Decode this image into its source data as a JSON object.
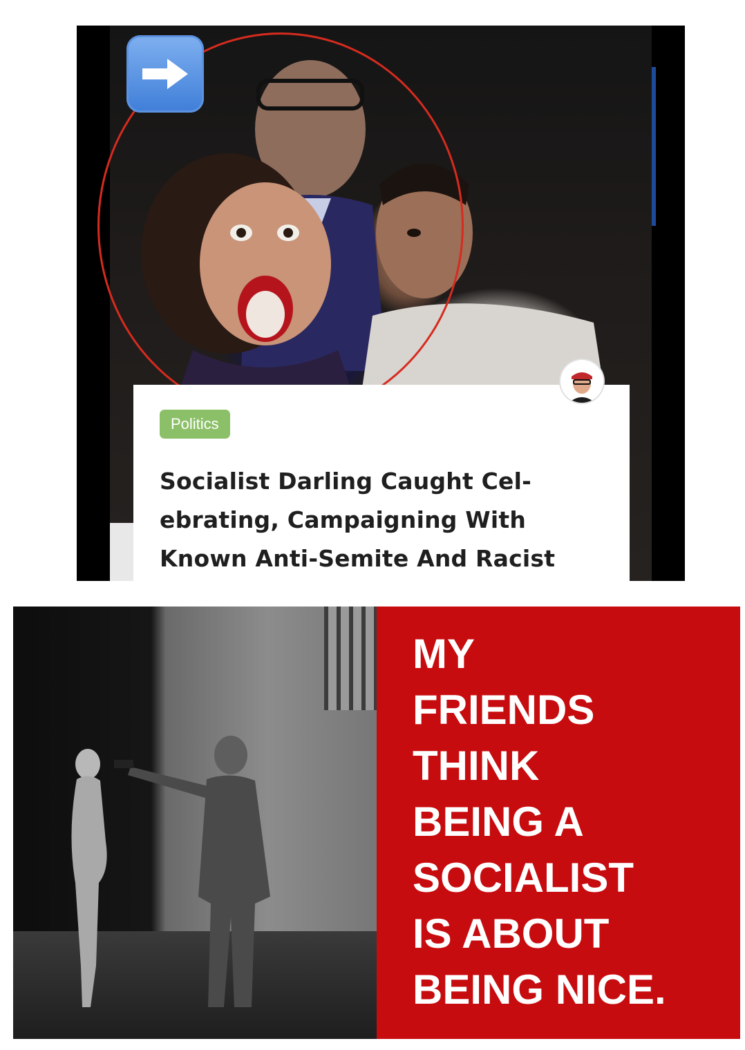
{
  "top_panel": {
    "arrow_icon": "right-arrow-icon",
    "card": {
      "tag": "Politics",
      "headline_lines": [
        "Socialist Darling Caught Cel-",
        "ebrating, Campaigning With",
        "Known Anti-Semite And Racist"
      ],
      "avatar_icon": "author-avatar-icon"
    },
    "colors": {
      "tag_background": "#8cc068",
      "circle_highlight": "#d62b1f"
    }
  },
  "bottom_panel": {
    "slogan_lines": [
      "MY",
      "FRIENDS",
      "THINK",
      "BEING A",
      "SOCIALIST",
      "IS ABOUT",
      "BEING NICE."
    ],
    "colors": {
      "slogan_background": "#c70c0f",
      "slogan_text": "#ffffff"
    }
  }
}
